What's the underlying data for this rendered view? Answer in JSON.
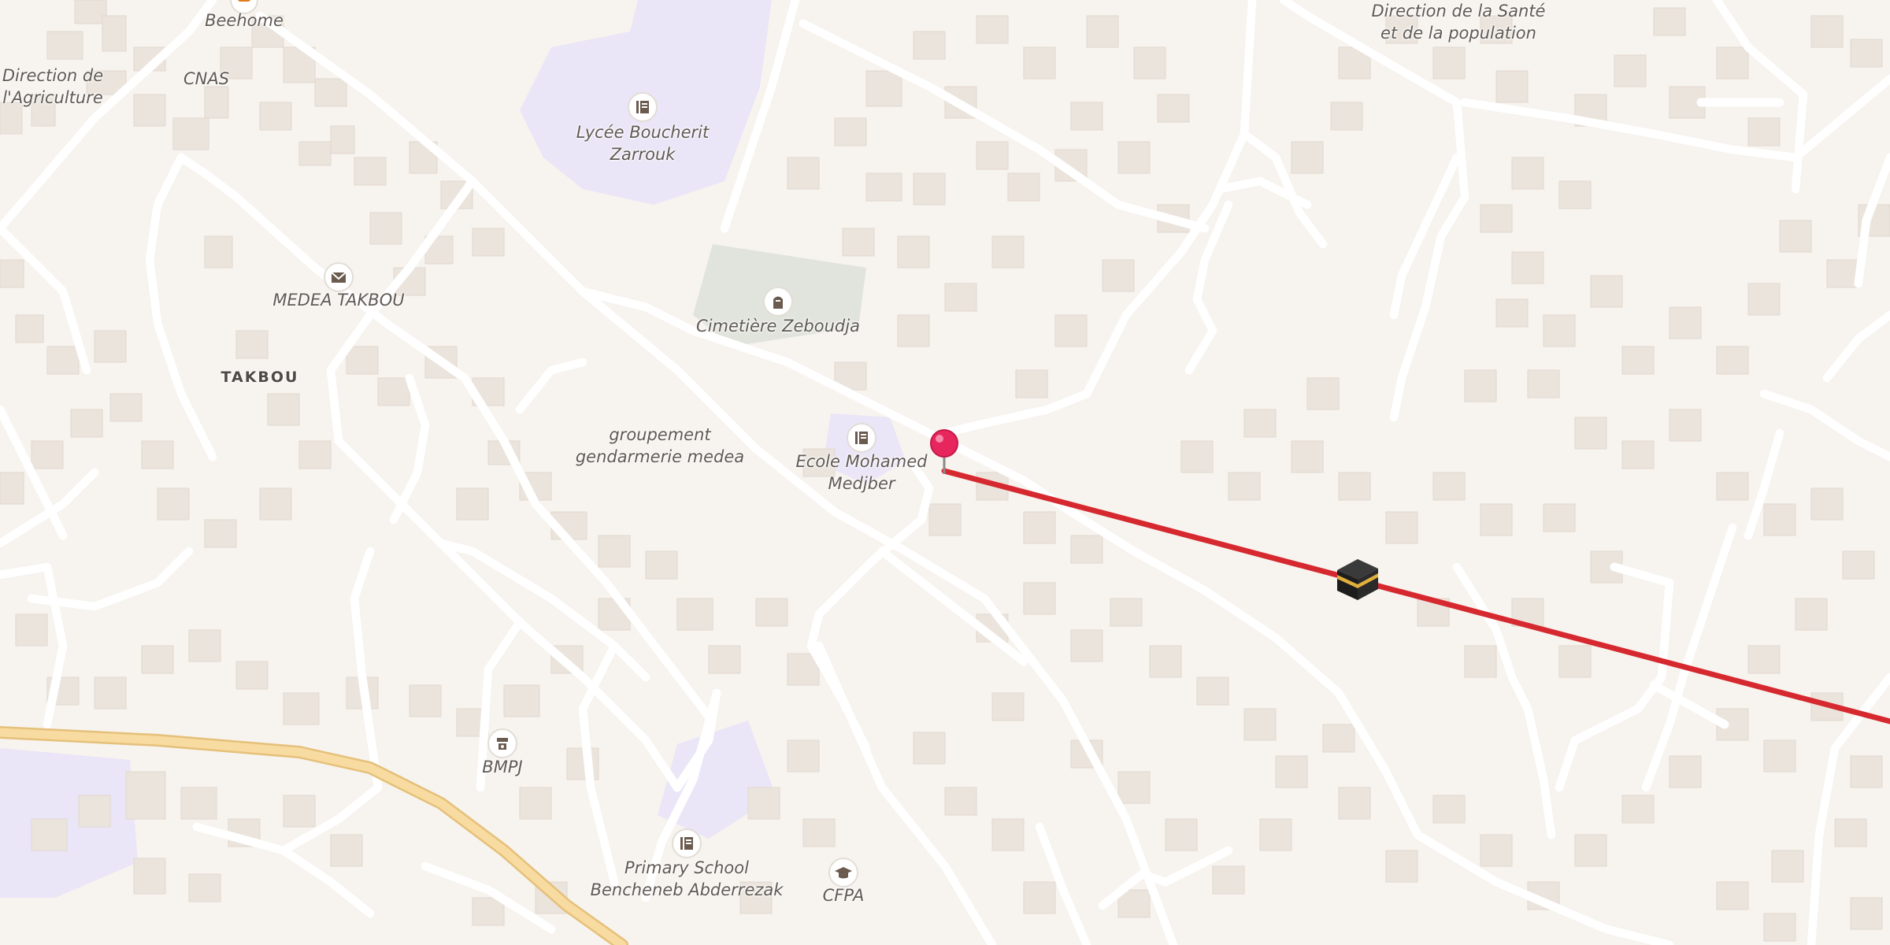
{
  "map": {
    "labels": {
      "beehome": "Beehome",
      "direction_agriculture": [
        "Direction de",
        "l'Agriculture"
      ],
      "cnas": "CNAS",
      "lycee": [
        "Lycée Boucherit",
        "Zarrouk"
      ],
      "direction_sante": [
        "Direction de la Santé",
        "et de la population"
      ],
      "medea_takbou": "MEDEA TAKBOU",
      "cimetiere": "Cimetière Zeboudja",
      "takbou": "TAKBOU",
      "gendarmerie": [
        "groupement",
        "gendarmerie medea"
      ],
      "ecole": [
        "Ecole Mohamed",
        "Medjber"
      ],
      "bmpj": "BMPJ",
      "primary_school": [
        "Primary School",
        "Bencheneb Abderrezak"
      ],
      "cfpa": "CFPA"
    },
    "icons": {
      "school": "school-icon",
      "post_office": "post-office-icon",
      "cemetery": "cemetery-icon",
      "police": "police-icon",
      "college": "graduation-cap-icon",
      "pin": "location-pin-icon",
      "kaaba": "kaaba-icon",
      "food": "food-icon"
    },
    "colors": {
      "background": "#f7f3ee",
      "building": "#ebe4dc",
      "road": "#ffffff",
      "main_road": "#f8dba0",
      "school_area": "#eae5f7",
      "cemetery_area": "#e1e4dc",
      "qibla_line": "#d6282f",
      "pin": "#e8265e"
    }
  }
}
